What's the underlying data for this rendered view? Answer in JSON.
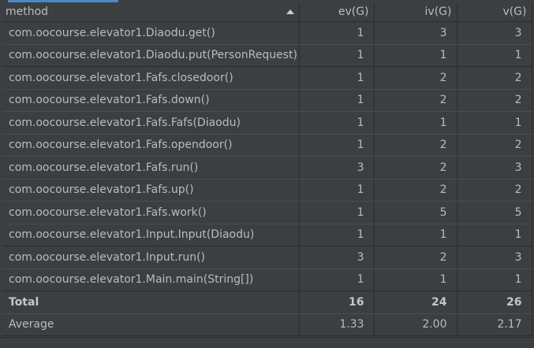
{
  "header": {
    "method": "method",
    "ev": "ev(G)",
    "iv": "iv(G)",
    "v": "v(G)"
  },
  "rows": [
    {
      "method": "com.oocourse.elevator1.Diaodu.get()",
      "ev": "1",
      "iv": "3",
      "v": "3"
    },
    {
      "method": "com.oocourse.elevator1.Diaodu.put(PersonRequest)",
      "ev": "1",
      "iv": "1",
      "v": "1"
    },
    {
      "method": "com.oocourse.elevator1.Fafs.closedoor()",
      "ev": "1",
      "iv": "2",
      "v": "2"
    },
    {
      "method": "com.oocourse.elevator1.Fafs.down()",
      "ev": "1",
      "iv": "2",
      "v": "2"
    },
    {
      "method": "com.oocourse.elevator1.Fafs.Fafs(Diaodu)",
      "ev": "1",
      "iv": "1",
      "v": "1"
    },
    {
      "method": "com.oocourse.elevator1.Fafs.opendoor()",
      "ev": "1",
      "iv": "2",
      "v": "2"
    },
    {
      "method": "com.oocourse.elevator1.Fafs.run()",
      "ev": "3",
      "iv": "2",
      "v": "3"
    },
    {
      "method": "com.oocourse.elevator1.Fafs.up()",
      "ev": "1",
      "iv": "2",
      "v": "2"
    },
    {
      "method": "com.oocourse.elevator1.Fafs.work()",
      "ev": "1",
      "iv": "5",
      "v": "5"
    },
    {
      "method": "com.oocourse.elevator1.Input.Input(Diaodu)",
      "ev": "1",
      "iv": "1",
      "v": "1"
    },
    {
      "method": "com.oocourse.elevator1.Input.run()",
      "ev": "3",
      "iv": "2",
      "v": "3"
    },
    {
      "method": "com.oocourse.elevator1.Main.main(String[])",
      "ev": "1",
      "iv": "1",
      "v": "1"
    }
  ],
  "total": {
    "label": "Total",
    "ev": "16",
    "iv": "24",
    "v": "26"
  },
  "average": {
    "label": "Average",
    "ev": "1.33",
    "iv": "2.00",
    "v": "2.17"
  },
  "icons": {
    "sort": "sort-ascending-icon"
  },
  "colors": {
    "background": "#3c3f41",
    "text": "#bbbbbb",
    "grid": "#2b2b2b",
    "accent": "#4a88c7"
  }
}
